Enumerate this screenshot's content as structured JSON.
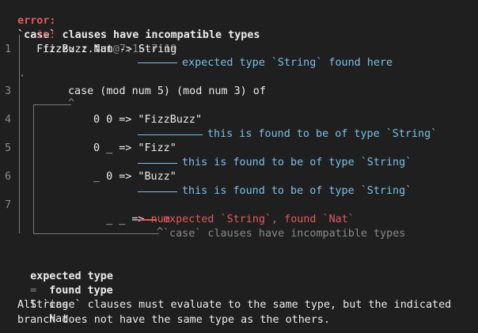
{
  "error": {
    "label": "error:",
    "message": "`case` clauses have incompatible types",
    "in_label": "in:",
    "location_file": "FizzBuzz.fun",
    "location_span": "@7:16-7:19"
  },
  "snippet": [
    {
      "number": "1",
      "code": "fizz₂ : Nat -> String"
    },
    {
      "number": "3",
      "code": "case (mod num 5) (mod num 3) of"
    },
    {
      "number": "4",
      "code": "0 0 => \"FizzBuzz\""
    },
    {
      "number": "5",
      "code": "0 _ => \"Fizz\""
    },
    {
      "number": "6",
      "code": "_ 0 => \"Buzz\""
    },
    {
      "number": "7",
      "code_prefix": "_ _ => ",
      "code_error": "num"
    }
  ],
  "annotations": {
    "expected_here": "expected type `String` found here",
    "found_string_1": "this is found to be of type `String`",
    "found_string_2": "this is found to be of type `String`",
    "found_string_3": "this is found to be of type `String`",
    "mismatch": "expected `String`, found `Nat`",
    "case_note": "`case` clauses have incompatible types"
  },
  "types": {
    "expected_label": "expected type",
    "expected_value": "String",
    "found_label": "found type",
    "found_value": "Nat",
    "equals": "="
  },
  "explanation": [
    "All `case` clauses must evaluate to the same type, but the indicated",
    "branch does not have the same type as the others."
  ],
  "colors": {
    "background": "#1f1f1f",
    "error": "#e45a5a",
    "note": "#79c0e8",
    "dim": "#8a8a8a"
  }
}
